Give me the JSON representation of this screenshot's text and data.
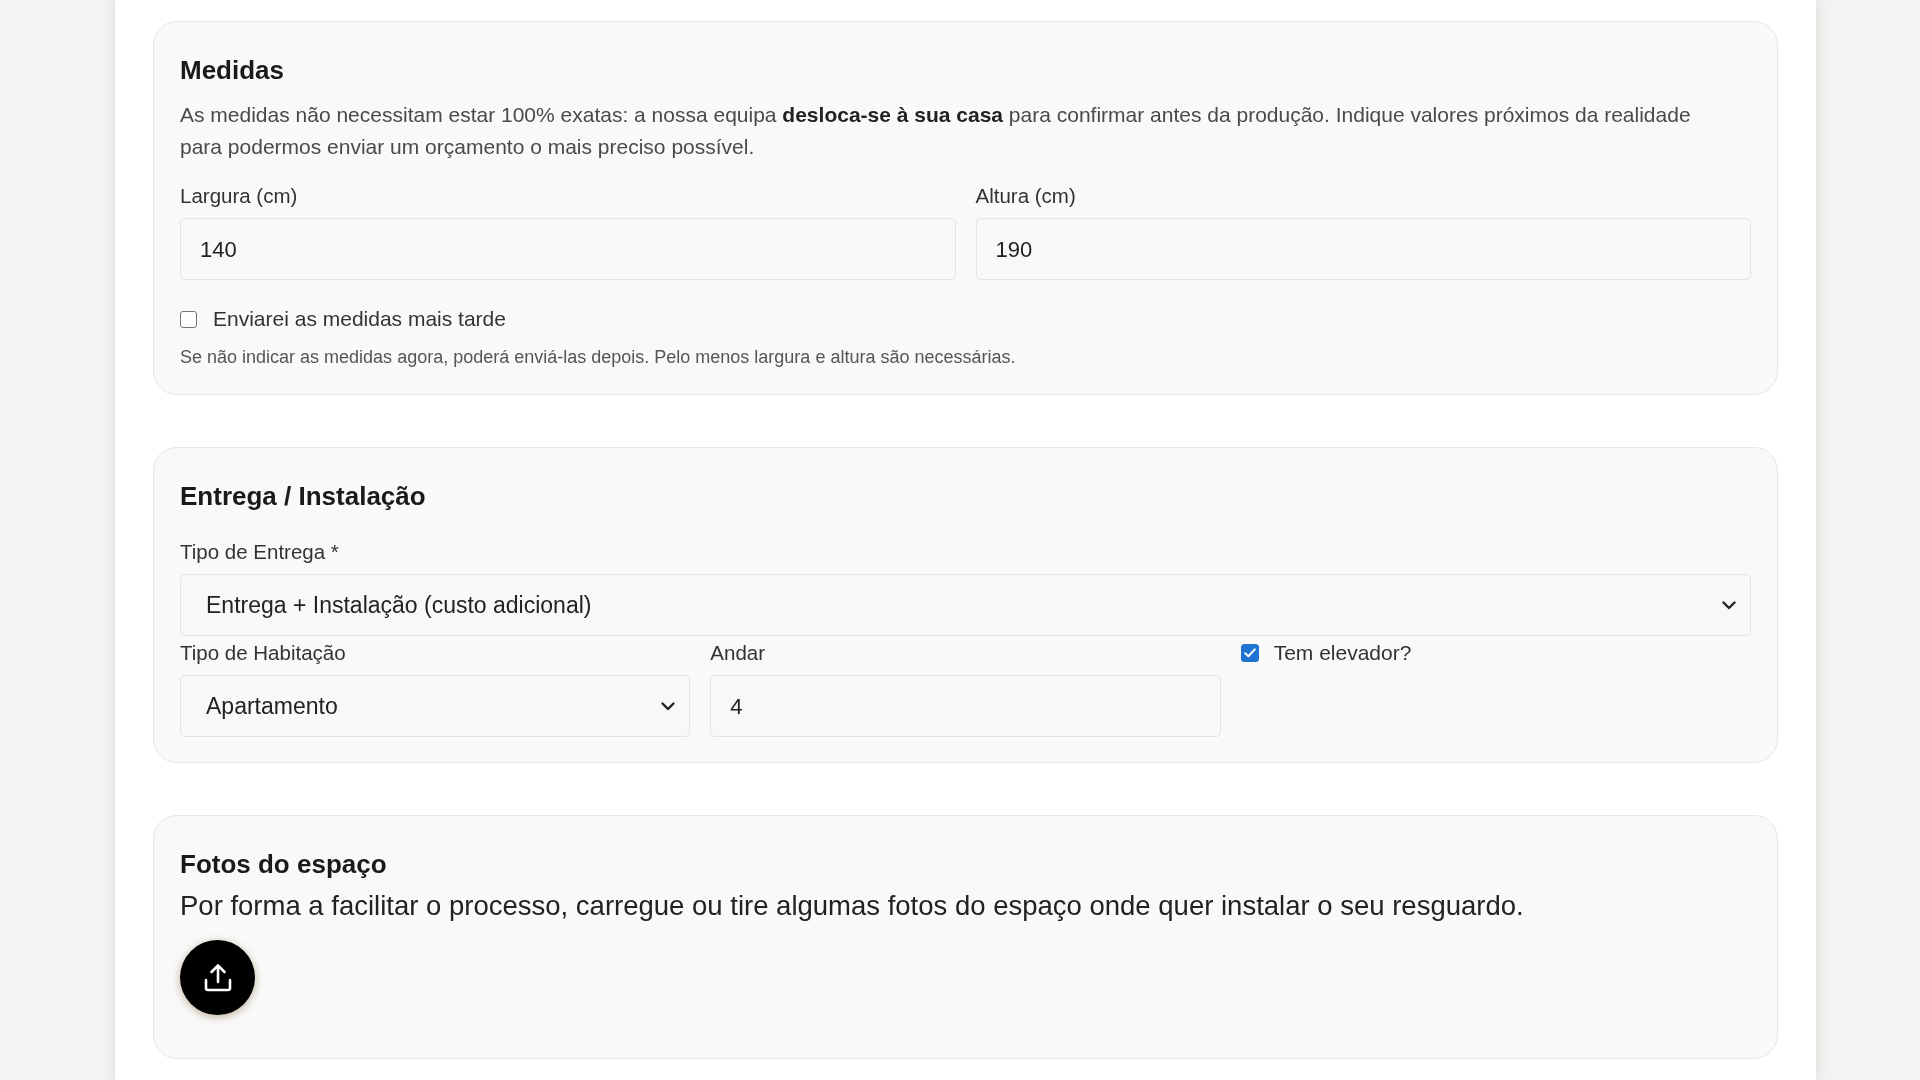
{
  "sections": [
    {
      "title": "Medidas",
      "items": [
        {
          "kind": "paragraph",
          "text": "As medidas não necessitam estar 100% exatas: a nossa equipa **desloca-se à sua casa** para confirmar antes da produção. Indique valores próximos da realidade para podermos enviar um orçamento o mais preciso possível."
        },
        {
          "kind": "row",
          "fields": [
            {
              "kind": "input",
              "label": "Largura (cm)",
              "value": "140"
            },
            {
              "kind": "input",
              "label": "Altura (cm)",
              "value": "190"
            }
          ]
        },
        {
          "kind": "checkbox",
          "label": "Enviarei as medidas mais tarde",
          "checked": false
        },
        {
          "kind": "note",
          "text": "Se não indicar as medidas agora, poderá enviá-las depois. Pelo menos largura e altura são necessárias."
        }
      ]
    },
    {
      "title": "Entrega / Instalação",
      "items": [
        {
          "kind": "row",
          "fields": [
            {
              "kind": "select",
              "label": "Tipo de Entrega *",
              "value": "Entrega + Instalação (custo adicional)"
            }
          ]
        },
        {
          "kind": "row",
          "fields": [
            {
              "kind": "select",
              "label": "Tipo de Habitação",
              "value": "Apartamento"
            },
            {
              "kind": "input",
              "label": "Andar",
              "value": "4"
            },
            {
              "kind": "checkbox",
              "label": "Tem elevador?",
              "checked": true
            }
          ]
        }
      ]
    },
    {
      "title": "Fotos do espaço",
      "items": [
        {
          "kind": "lead",
          "text": "Por forma a facilitar o processo, carregue ou tire algumas fotos do espaço onde quer instalar o seu resguardo."
        },
        {
          "kind": "upload"
        }
      ]
    }
  ]
}
